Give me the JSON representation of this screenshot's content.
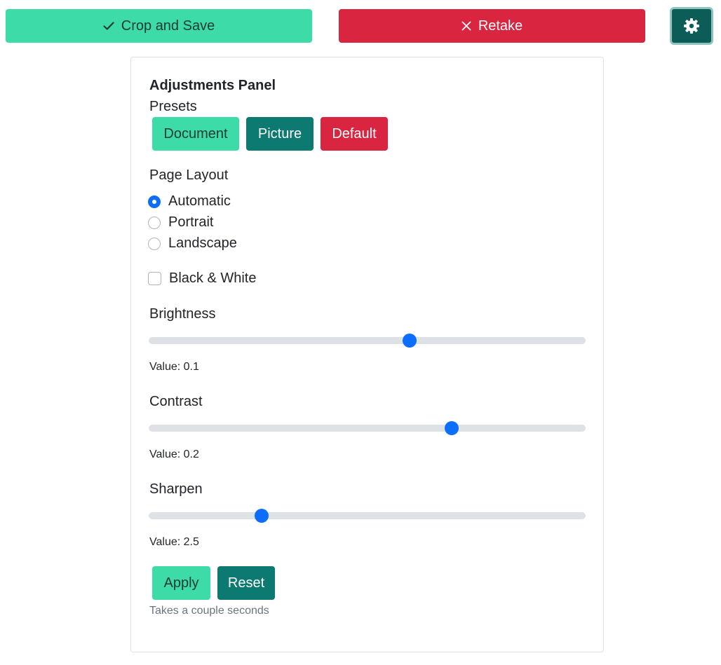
{
  "toolbar": {
    "crop_save_label": "Crop and Save",
    "retake_label": "Retake",
    "crop_icon": "check-icon",
    "retake_icon": "close-icon",
    "settings_icon": "gear-icon"
  },
  "panel": {
    "title": "Adjustments Panel",
    "presets": {
      "label": "Presets",
      "buttons": [
        "Document",
        "Picture",
        "Default"
      ]
    },
    "page_layout": {
      "label": "Page Layout",
      "options": [
        "Automatic",
        "Portrait",
        "Landscape"
      ],
      "selected": "Automatic"
    },
    "black_white": {
      "label": "Black & White",
      "checked": false
    },
    "sliders": [
      {
        "label": "Brightness",
        "value_text": "Value: 0.1",
        "fill_fraction": 0.597
      },
      {
        "label": "Contrast",
        "value_text": "Value: 0.2",
        "fill_fraction": 0.694
      },
      {
        "label": "Sharpen",
        "value_text": "Value: 2.5",
        "fill_fraction": 0.258
      }
    ],
    "actions": {
      "apply_label": "Apply",
      "reset_label": "Reset",
      "hint": "Takes a couple seconds"
    }
  },
  "colors": {
    "green": "#3ddba7",
    "teal": "#0c7a70",
    "dark_teal": "#0c5d58",
    "red": "#d9253f",
    "blue": "#0d6efd"
  }
}
